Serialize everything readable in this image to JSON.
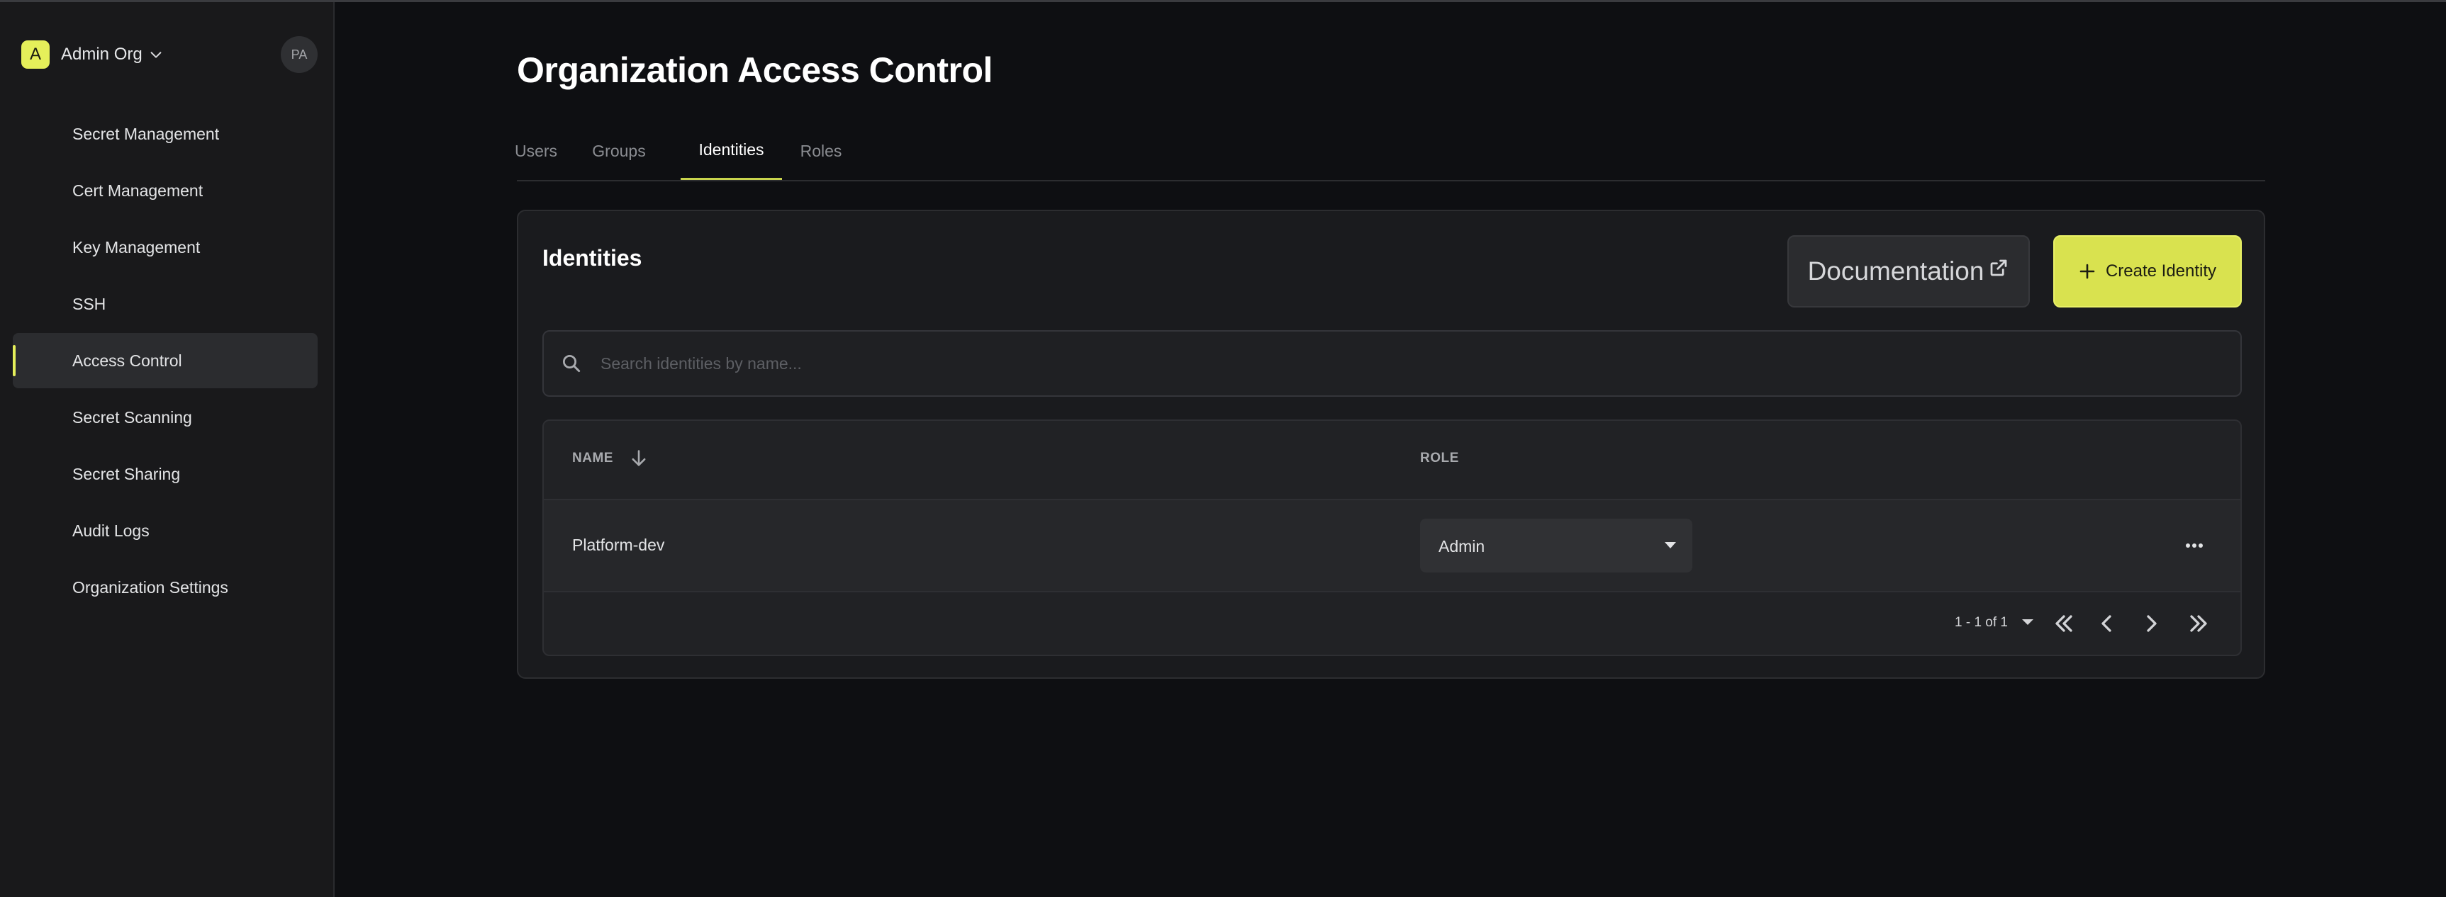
{
  "colors": {
    "accent": "#e5ef5a",
    "background": "#0e0f12",
    "sidebar": "#19191b",
    "card": "#1a1b1e"
  },
  "org": {
    "badge_letter": "A",
    "name": "Admin Org",
    "chevron_icon": "chevron-down-icon"
  },
  "user": {
    "initials": "PA"
  },
  "sidebar": {
    "items": [
      {
        "label": "Secret Management",
        "active": false
      },
      {
        "label": "Cert Management",
        "active": false
      },
      {
        "label": "Key Management",
        "active": false
      },
      {
        "label": "SSH",
        "active": false
      },
      {
        "label": "Access Control",
        "active": true
      },
      {
        "label": "Secret Scanning",
        "active": false
      },
      {
        "label": "Secret Sharing",
        "active": false
      },
      {
        "label": "Audit Logs",
        "active": false
      },
      {
        "label": "Organization Settings",
        "active": false
      }
    ]
  },
  "page": {
    "title": "Organization Access Control"
  },
  "tabs": [
    {
      "label": "Users",
      "active": false
    },
    {
      "label": "Groups",
      "active": false
    },
    {
      "label": "Identities",
      "active": true
    },
    {
      "label": "Roles",
      "active": false
    }
  ],
  "card": {
    "title": "Identities",
    "doc_button": {
      "label": "Documentation",
      "icon": "external-link-icon"
    },
    "create_button": {
      "label": "Create Identity",
      "icon": "plus-icon"
    }
  },
  "search": {
    "placeholder": "Search identities by name...",
    "value": "",
    "icon": "search-icon"
  },
  "table": {
    "columns": [
      "NAME",
      "ROLE"
    ],
    "sort_icon": "arrow-down-icon",
    "rows": [
      {
        "name": "Platform-dev",
        "role": "Admin"
      }
    ]
  },
  "pagination": {
    "range": "1 - 1 of 1",
    "buttons": [
      "first-page-icon",
      "prev-page-icon",
      "next-page-icon",
      "last-page-icon"
    ]
  }
}
